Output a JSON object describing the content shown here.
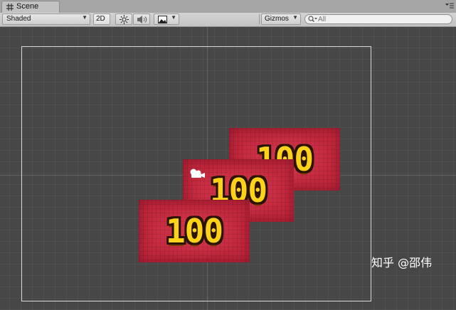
{
  "tab": {
    "title": "Scene",
    "icon": "grid-icon"
  },
  "toolbar": {
    "shading_mode": "Shaded",
    "mode_2d": "2D",
    "gizmos": "Gizmos",
    "search_placeholder": "All",
    "icons": [
      "sun-icon",
      "speaker-icon",
      "image-icon"
    ]
  },
  "scene": {
    "sprites": [
      {
        "label": "100"
      },
      {
        "label": "100"
      },
      {
        "label": "100"
      }
    ],
    "colors": {
      "sprite_fill": "#c3283e",
      "number_fill": "#ffd21a",
      "background": "#474747"
    }
  },
  "watermark": "知乎 @邵伟"
}
